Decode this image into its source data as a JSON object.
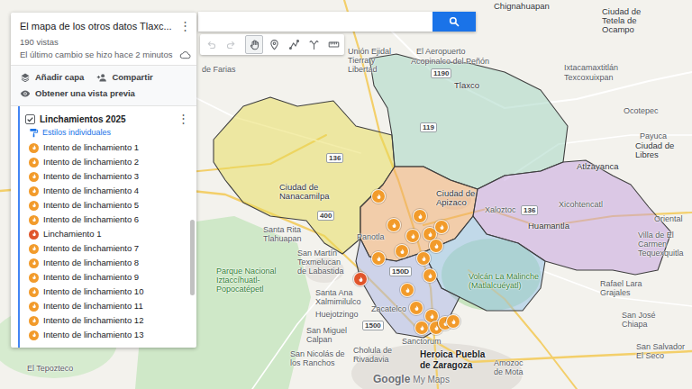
{
  "panel": {
    "title": "El mapa de los otros datos Tlaxc...",
    "menu": "⋮",
    "views": "190 vistas",
    "last_change": "El último cambio se hizo hace 2 minutos",
    "actions": [
      {
        "label": "Añadir capa",
        "kind": "add-layer"
      },
      {
        "label": "Compartir",
        "kind": "share"
      },
      {
        "label": "Obtener una vista previa",
        "kind": "preview"
      }
    ],
    "layer": {
      "name": "Linchamientos 2025",
      "checked": true,
      "menu": "⋮",
      "style": "Estilos individuales",
      "items": [
        {
          "label": "Intento de linchamiento 1",
          "kind": "attempt",
          "color": "#f29b2b"
        },
        {
          "label": "Intento de linchamiento 2",
          "kind": "attempt",
          "color": "#f29b2b"
        },
        {
          "label": "Intento de linchamiento 3",
          "kind": "attempt",
          "color": "#f29b2b"
        },
        {
          "label": "Intento de linchamiento 4",
          "kind": "attempt",
          "color": "#f29b2b"
        },
        {
          "label": "Intento de linchamiento 5",
          "kind": "attempt",
          "color": "#f29b2b"
        },
        {
          "label": "Intento de linchamiento 6",
          "kind": "attempt",
          "color": "#f29b2b"
        },
        {
          "label": "Linchamiento 1",
          "kind": "lynching",
          "color": "#e0552b"
        },
        {
          "label": "Intento de linchamiento 7",
          "kind": "attempt",
          "color": "#f29b2b"
        },
        {
          "label": "Intento de linchamiento 8",
          "kind": "attempt",
          "color": "#f29b2b"
        },
        {
          "label": "Intento de linchamiento 9",
          "kind": "attempt",
          "color": "#f29b2b"
        },
        {
          "label": "Intento de linchamiento 10",
          "kind": "attempt",
          "color": "#f29b2b"
        },
        {
          "label": "Intento de linchamiento 11",
          "kind": "attempt",
          "color": "#f29b2b"
        },
        {
          "label": "Intento de linchamiento 12",
          "kind": "attempt",
          "color": "#f29b2b"
        },
        {
          "label": "Intento de linchamiento 13",
          "kind": "attempt",
          "color": "#f29b2b"
        }
      ]
    }
  },
  "search": {
    "value": ""
  },
  "toolbar": [
    {
      "kind": "undo",
      "disabled": true,
      "selected": false
    },
    {
      "kind": "redo",
      "disabled": true,
      "selected": false
    },
    {
      "kind": "hand",
      "disabled": false,
      "selected": true
    },
    {
      "kind": "marker",
      "disabled": false,
      "selected": false
    },
    {
      "kind": "line",
      "disabled": false,
      "selected": false
    },
    {
      "kind": "route",
      "disabled": false,
      "selected": false
    },
    {
      "kind": "ruler",
      "disabled": false,
      "selected": false
    }
  ],
  "map": {
    "regions": [
      {
        "color": "#e8dc55"
      },
      {
        "color": "#9fd3c0"
      },
      {
        "color": "#f2a768"
      },
      {
        "color": "#c39ddd"
      },
      {
        "color": "#90bfe6"
      },
      {
        "color": "#aab3e6"
      }
    ],
    "markers": [
      {
        "kind": "attempt",
        "color": "#f29b2b"
      },
      {
        "kind": "attempt",
        "color": "#f29b2b"
      },
      {
        "kind": "attempt",
        "color": "#f29b2b"
      },
      {
        "kind": "attempt",
        "color": "#f29b2b"
      },
      {
        "kind": "attempt",
        "color": "#f29b2b"
      },
      {
        "kind": "attempt",
        "color": "#f29b2b"
      },
      {
        "kind": "attempt",
        "color": "#f29b2b"
      },
      {
        "kind": "attempt",
        "color": "#f29b2b"
      },
      {
        "kind": "attempt",
        "color": "#f29b2b"
      },
      {
        "kind": "attempt",
        "color": "#f29b2b"
      },
      {
        "kind": "attempt",
        "color": "#f29b2b"
      },
      {
        "kind": "attempt",
        "color": "#f29b2b"
      },
      {
        "kind": "attempt",
        "color": "#f29b2b"
      },
      {
        "kind": "attempt",
        "color": "#f29b2b"
      },
      {
        "kind": "attempt",
        "color": "#f29b2b"
      },
      {
        "kind": "attempt",
        "color": "#f29b2b"
      },
      {
        "kind": "lynching",
        "color": "#e0552b"
      },
      {
        "kind": "attempt",
        "color": "#f29b2b"
      },
      {
        "kind": "attempt",
        "color": "#f29b2b"
      }
    ],
    "labels": [
      {
        "text": "Chignahuapan",
        "kind": "town"
      },
      {
        "text": "Ciudad de Tetela de Ocampo",
        "kind": "town"
      },
      {
        "text": "Unión Ejidal Tierra y Libertad",
        "kind": "small"
      },
      {
        "text": "El Aeropuerto",
        "kind": "small"
      },
      {
        "text": "Acopinalco del Peñón",
        "kind": "small"
      },
      {
        "text": "Tlaxco",
        "kind": "town"
      },
      {
        "text": "Ixtacamaxtitlán",
        "kind": "small"
      },
      {
        "text": "Texcoxuixpan",
        "kind": "small"
      },
      {
        "text": "Ocotepec",
        "kind": "small"
      },
      {
        "text": "Payuca",
        "kind": "small"
      },
      {
        "text": "Ciudad de Libres",
        "kind": "town"
      },
      {
        "text": "Atlzayanca",
        "kind": "town"
      },
      {
        "text": "Xicohtencatl",
        "kind": "small"
      },
      {
        "text": "Oriental",
        "kind": "small"
      },
      {
        "text": "Huamantla",
        "kind": "town"
      },
      {
        "text": "Villa de El Carmen Tequexquitla",
        "kind": "small"
      },
      {
        "text": "Xaloztoc",
        "kind": "small"
      },
      {
        "text": "Ciudad de Apizaco",
        "kind": "town"
      },
      {
        "text": "Ciudad de Nanacamilpa",
        "kind": "town"
      },
      {
        "text": "Panotla",
        "kind": "small"
      },
      {
        "text": "Santa Rita Tlahuapan",
        "kind": "small"
      },
      {
        "text": "San Martín Texmelucan de Labastida",
        "kind": "small"
      },
      {
        "text": "Santa Ana Xalmimilulco",
        "kind": "small"
      },
      {
        "text": "Parque Nacional Iztaccíhuatl-Popocatépetl",
        "kind": "park"
      },
      {
        "text": "Zacatelco",
        "kind": "small"
      },
      {
        "text": "Volcán La Malinche (Matlalcuéyatl)",
        "kind": "park"
      },
      {
        "text": "Huejotzingo",
        "kind": "small"
      },
      {
        "text": "San Miguel Calpan",
        "kind": "small"
      },
      {
        "text": "San Nicolás de los Ranchos",
        "kind": "small"
      },
      {
        "text": "Cholula de Rivadavia",
        "kind": "small"
      },
      {
        "text": "Sanctorum",
        "kind": "small"
      },
      {
        "text": "Heroica Puebla de Zaragoza",
        "kind": "city"
      },
      {
        "text": "Amozoc de Mota",
        "kind": "small"
      },
      {
        "text": "Rafael Lara Grajales",
        "kind": "small"
      },
      {
        "text": "San José Chiapa",
        "kind": "small"
      },
      {
        "text": "San Salvador El Seco",
        "kind": "small"
      },
      {
        "text": "El Tepozteco",
        "kind": "small"
      },
      {
        "text": "de Farias",
        "kind": "small"
      }
    ],
    "shields": [
      {
        "text": "1190"
      },
      {
        "text": "119"
      },
      {
        "text": "136"
      },
      {
        "text": "400"
      },
      {
        "text": "136"
      },
      {
        "text": "150D"
      },
      {
        "text": "1500"
      }
    ],
    "attribution": {
      "logo": "Google",
      "product": "My Maps"
    }
  }
}
